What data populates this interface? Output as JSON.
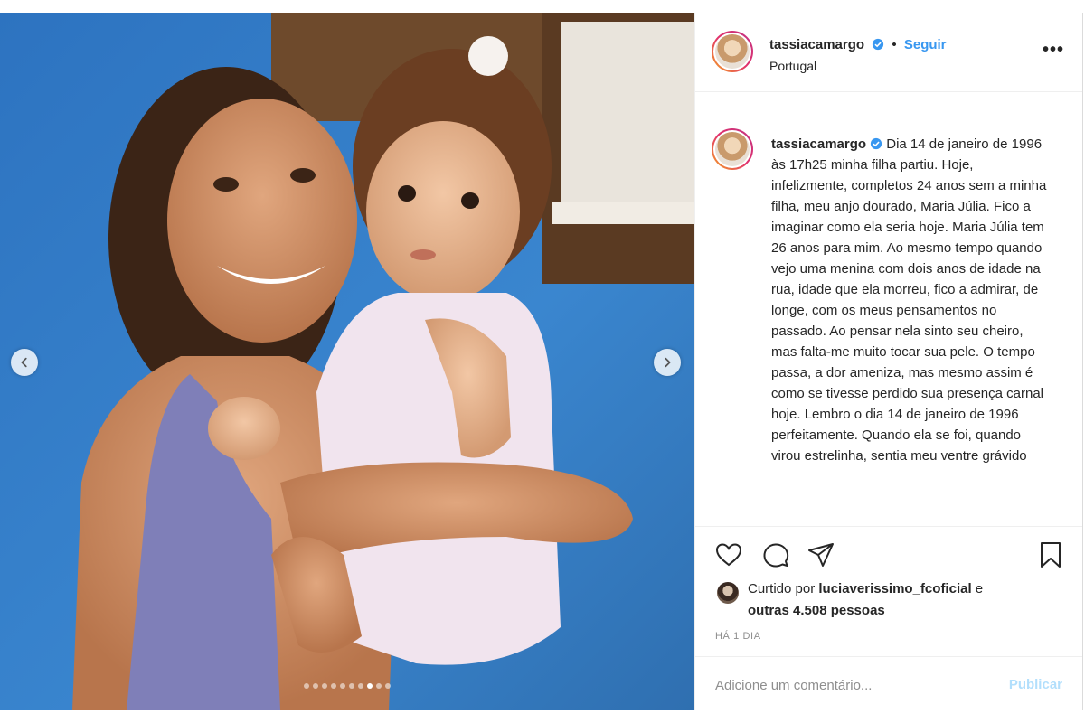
{
  "post": {
    "username": "tassiacamargo",
    "separator": "•",
    "follow_label": "Seguir",
    "location": "Portugal",
    "more_label": "•••",
    "caption_text": "Dia 14 de janeiro de 1996 às 17h25 minha filha partiu. Hoje, infelizmente, completos 24 anos sem a minha filha, meu anjo dourado, Maria Júlia. Fico a imaginar como ela seria hoje. Maria Júlia tem 26 anos para mim. Ao mesmo tempo quando vejo uma menina com dois anos de idade na rua, idade que ela morreu, fico a admirar, de longe, com os meus pensamentos no passado. Ao pensar nela sinto seu cheiro, mas falta-me muito tocar sua pele. O tempo passa, a dor ameniza, mas mesmo assim é como se tivesse perdido sua presença carnal hoje. Lembro o dia 14 de janeiro de 1996 perfeitamente. Quando ela se foi, quando virou estrelinha, sentia meu ventre grávido",
    "liked_by_prefix": "Curtido por",
    "liked_by_user": "luciaverissimo_fcoficial",
    "liked_by_suffix": "e",
    "liked_by_others": "outras 4.508 pessoas",
    "time_ago": "HÁ 1 DIA",
    "comment_placeholder": "Adicione um comentário...",
    "publish_label": "Publicar"
  },
  "carousel": {
    "total": 10,
    "active_index": 7
  },
  "icons": {
    "verified": "verified-badge-icon",
    "prev": "chevron-left-icon",
    "next": "chevron-right-icon",
    "like": "heart-icon",
    "comment": "comment-icon",
    "share": "paper-plane-icon",
    "save": "bookmark-icon"
  },
  "colors": {
    "link_blue": "#3897f0",
    "publish_disabled": "#b2dffc",
    "secondary_text": "#8e8e8e"
  }
}
